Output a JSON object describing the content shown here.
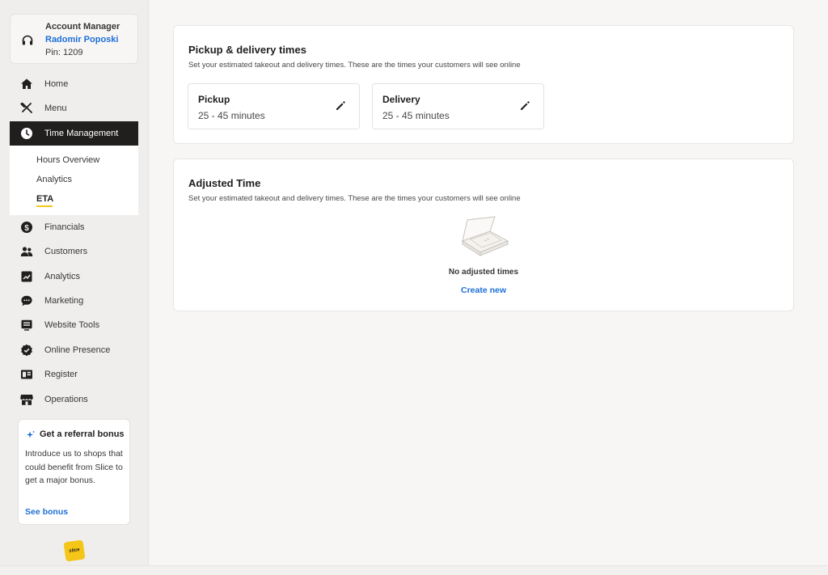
{
  "account": {
    "role": "Account Manager",
    "name": "Radomir Poposki",
    "pin": "Pin: 1209"
  },
  "nav": {
    "home": "Home",
    "menu": "Menu",
    "time_management": "Time Management",
    "sub": {
      "hours_overview": "Hours Overview",
      "analytics": "Analytics",
      "eta": "ETA"
    },
    "financials": "Financials",
    "customers": "Customers",
    "analytics": "Analytics",
    "marketing": "Marketing",
    "website_tools": "Website Tools",
    "online_presence": "Online Presence",
    "register": "Register",
    "operations": "Operations"
  },
  "referral": {
    "title": "Get a referral bonus",
    "body": "Introduce us to shops that could benefit from Slice to get a major bonus.",
    "link": "See bonus"
  },
  "logo_text": "slice",
  "pickup_delivery": {
    "title": "Pickup & delivery times",
    "subtitle": "Set your estimated takeout and delivery times. These are the times your customers will see online",
    "pickup_label": "Pickup",
    "pickup_value": "25 - 45 minutes",
    "delivery_label": "Delivery",
    "delivery_value": "25 - 45 minutes"
  },
  "adjusted": {
    "title": "Adjusted Time",
    "subtitle": "Set your estimated takeout and delivery times. These are the times your customers will see online",
    "empty_text": "No adjusted times",
    "create_link": "Create new"
  },
  "colors": {
    "accent_link": "#1d6fd6",
    "active_nav_bg": "#211e1e",
    "brand_yellow": "#f5c518"
  }
}
